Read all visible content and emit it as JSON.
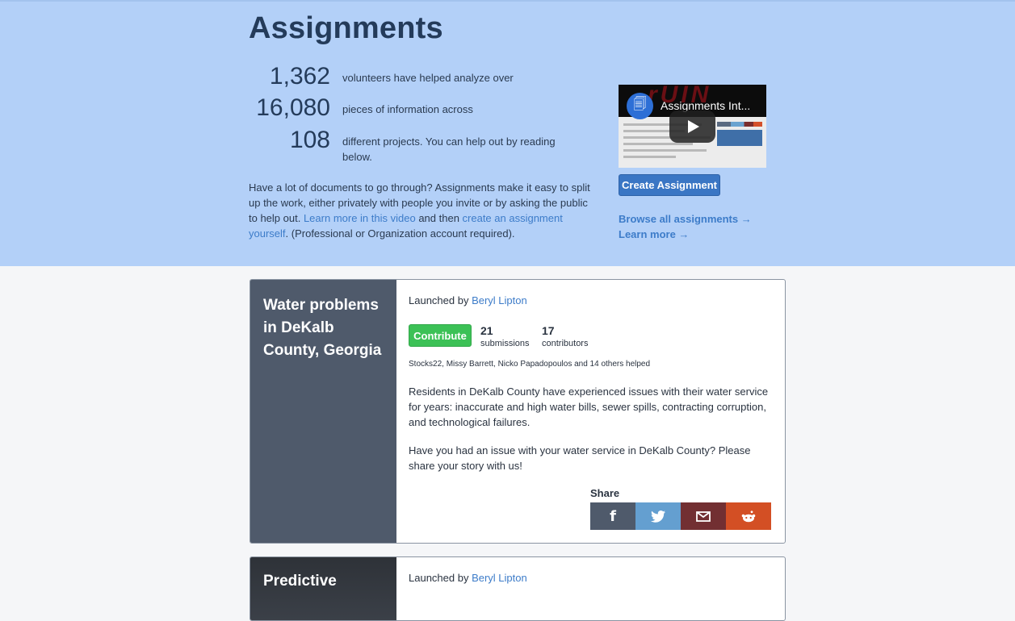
{
  "header": {
    "title": "Assignments",
    "stats": [
      {
        "value": "1,362",
        "text": "volunteers have helped analyze over"
      },
      {
        "value": "16,080",
        "text": "pieces of information across"
      },
      {
        "value": "108",
        "text": "different projects. You can help out by reading below."
      }
    ],
    "intro": {
      "part1": "Have a lot of documents to go through? Assignments make it easy to split up the work, either privately with people you invite or by asking the public to help out. ",
      "link1": "Learn more in this video",
      "part2": " and then ",
      "link2": "create an assignment yourself",
      "part3": ". (Professional or Organization account required)."
    },
    "video": {
      "title": "Assignments Int...",
      "icon": "document-icon",
      "play_icon": "play-icon"
    },
    "create_button": "Create Assignment",
    "links": [
      {
        "label": "Browse all assignments →"
      },
      {
        "label": "Learn more →"
      }
    ]
  },
  "assignments": [
    {
      "title": "Water problems in DeKalb County, Georgia",
      "launched_prefix": "Launched by ",
      "launched_by": "Beryl Lipton",
      "contribute_label": "Contribute",
      "submissions": "21",
      "submissions_label": "submissions",
      "contributors": "17",
      "contributors_label": "contributors",
      "helpers": "Stocks22, Missy Barrett, Nicko Papadopoulos and 14 others helped",
      "description": [
        "Residents in DeKalb County have experienced issues with their water service for years: inaccurate and high water bills, sewer spills, contracting corruption, and technological failures.",
        "Have you had an issue with your water service in DeKalb County? Please share your story with us!"
      ],
      "share_label": "Share",
      "share_buttons": [
        {
          "name": "facebook",
          "icon": "facebook-icon",
          "glyph": "f",
          "color": "#4f5a6b"
        },
        {
          "name": "twitter",
          "icon": "twitter-icon",
          "color": "#649fd0"
        },
        {
          "name": "email",
          "icon": "email-icon",
          "color": "#722f32"
        },
        {
          "name": "reddit",
          "icon": "reddit-icon",
          "color": "#d34f24"
        }
      ]
    },
    {
      "title": "Predictive",
      "launched_prefix": "Launched by ",
      "launched_by": "Beryl Lipton"
    }
  ],
  "colors": {
    "hero_bg": "#b3d0f8",
    "link": "#3d7cc9",
    "contribute": "#3cc156",
    "primary_button": "#3a76c4"
  }
}
